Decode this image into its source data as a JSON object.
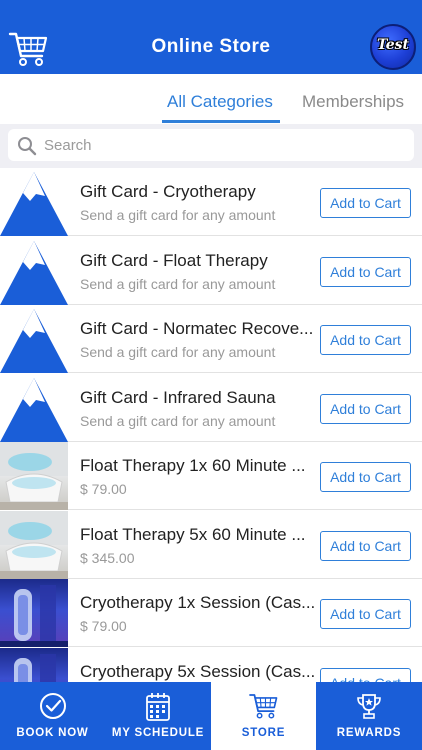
{
  "header": {
    "title": "Online Store",
    "cart_icon": "cart-icon",
    "avatar_text": "Test",
    "color": "#1a5ed8"
  },
  "tabs": [
    {
      "label": "All Categories",
      "active": true
    },
    {
      "label": "Memberships",
      "active": false
    }
  ],
  "search": {
    "placeholder": "Search",
    "value": ""
  },
  "items": [
    {
      "name": "Gift Card - Cryotherapy",
      "subtitle": "Send a gift card for any amount",
      "button": "Add to Cart",
      "thumb": "mountain-logo"
    },
    {
      "name": "Gift Card - Float Therapy",
      "subtitle": "Send a gift card for any amount",
      "button": "Add to Cart",
      "thumb": "mountain-logo"
    },
    {
      "name": "Gift Card - Normatec Recove...",
      "subtitle": "Send a gift card for any amount",
      "button": "Add to Cart",
      "thumb": "mountain-logo"
    },
    {
      "name": "Gift Card - Infrared Sauna",
      "subtitle": "Send a gift card for any amount",
      "button": "Add to Cart",
      "thumb": "mountain-logo"
    },
    {
      "name": "Float Therapy 1x 60 Minute ...",
      "subtitle": "$ 79.00",
      "button": "Add to Cart",
      "thumb": "float-pod-photo"
    },
    {
      "name": "Float Therapy 5x 60 Minute ...",
      "subtitle": "$ 345.00",
      "button": "Add to Cart",
      "thumb": "float-pod-photo"
    },
    {
      "name": "Cryotherapy 1x Session (Cas...",
      "subtitle": "$ 79.00",
      "button": "Add to Cart",
      "thumb": "cryo-chamber-photo"
    },
    {
      "name": "Cryotherapy 5x Session (Cas...",
      "subtitle": "",
      "button": "Add to Cart",
      "thumb": "cryo-chamber-photo"
    }
  ],
  "tabbar": [
    {
      "label": "BOOK NOW",
      "icon": "check-circle-icon",
      "active": false
    },
    {
      "label": "MY SCHEDULE",
      "icon": "calendar-icon",
      "active": false
    },
    {
      "label": "STORE",
      "icon": "cart-icon",
      "active": true
    },
    {
      "label": "REWARDS",
      "icon": "trophy-icon",
      "active": false
    }
  ],
  "colors": {
    "brand_blue": "#1a5ed8",
    "accent": "#2f7fd9"
  }
}
